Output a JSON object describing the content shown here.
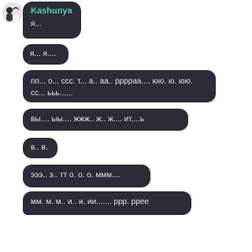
{
  "chat": {
    "sender_name": "Kashunya",
    "messages": [
      {
        "text": "я..."
      },
      {
        "text": "я... я...."
      },
      {
        "text": "пп... о... ссс. т... а.. аа.. ррррaa.... юю. ю. юю. сс... ььь......"
      },
      {
        "text": "вы.... ыы.... жжж.. ж.. ж.... ит....ь"
      },
      {
        "text": "в.. в."
      },
      {
        "text": "эээ.. э.. тт о. о. о. ммм...."
      },
      {
        "text": "мм. м. м.. и.. и. ии....... ррр. ppee"
      }
    ]
  }
}
